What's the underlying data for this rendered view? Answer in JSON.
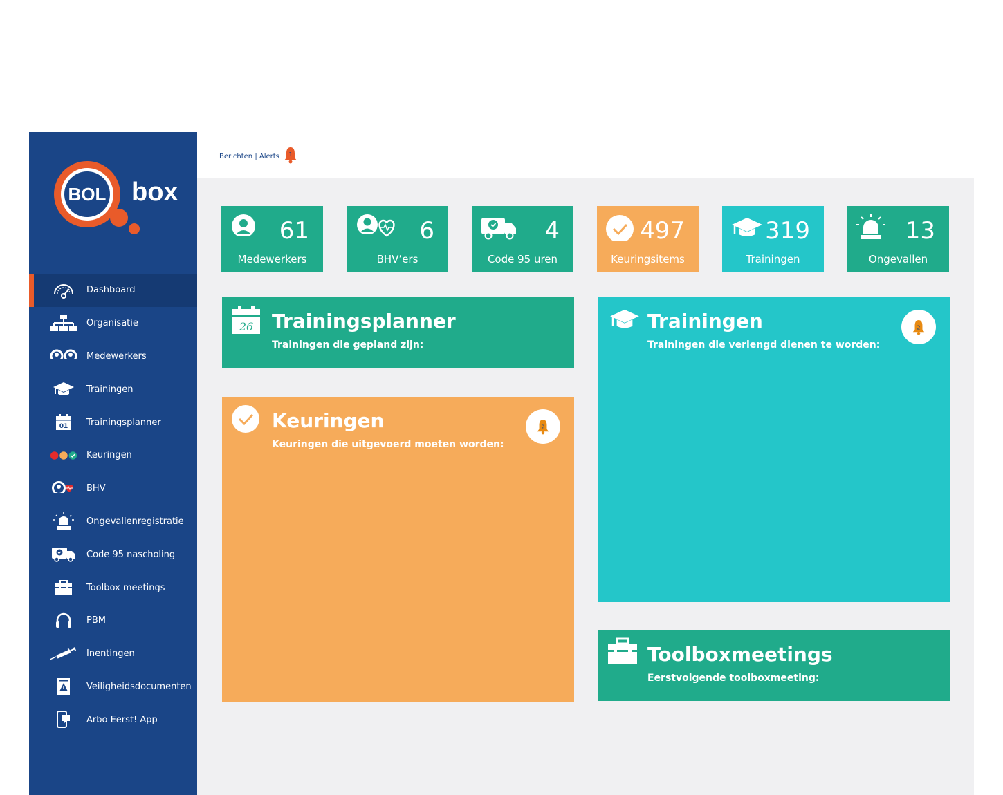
{
  "brand": {
    "logo_left": "BOL",
    "logo_right": "box",
    "primary": "#1a4587",
    "accent": "#e95b2a"
  },
  "topbar": {
    "link_text": "Berichten | Alerts",
    "alert_count": "1"
  },
  "sidebar": {
    "items": [
      {
        "label": "Dashboard",
        "icon": "gauge-icon"
      },
      {
        "label": "Organisatie",
        "icon": "org-chart-icon"
      },
      {
        "label": "Medewerkers",
        "icon": "people-icon"
      },
      {
        "label": "Trainingen",
        "icon": "graduation-cap-icon"
      },
      {
        "label": "Trainingsplanner",
        "icon": "calendar-icon",
        "day": "01"
      },
      {
        "label": "Keuringen",
        "icon": "status-dots-icon"
      },
      {
        "label": "BHV",
        "icon": "person-heart-icon"
      },
      {
        "label": "Ongevallenregistratie",
        "icon": "alarm-light-icon"
      },
      {
        "label": "Code 95 nascholing",
        "icon": "truck-icon"
      },
      {
        "label": "Toolbox meetings",
        "icon": "toolbox-icon"
      },
      {
        "label": "PBM",
        "icon": "headphones-icon"
      },
      {
        "label": "Inentingen",
        "icon": "syringe-icon"
      },
      {
        "label": "Veiligheidsdocumenten",
        "icon": "warning-document-icon"
      },
      {
        "label": "Arbo Eerst! App",
        "icon": "mobile-app-icon"
      }
    ]
  },
  "stats": [
    {
      "value": "61",
      "label": "Medewerkers",
      "icon": "person-icon",
      "color": "#20ab8b"
    },
    {
      "value": "6",
      "label": "BHV’ers",
      "icon": "person-heart-icon",
      "color": "#20ab8b"
    },
    {
      "value": "4",
      "label": "Code 95 uren",
      "icon": "truck-icon",
      "color": "#20ab8b"
    },
    {
      "value": "497",
      "label": "Keuringsitems",
      "icon": "check-circle-icon",
      "color": "#f6ab5a"
    },
    {
      "value": "319",
      "label": "Trainingen",
      "icon": "graduation-cap-icon",
      "color": "#24c6c9"
    },
    {
      "value": "13",
      "label": "Ongevallen",
      "icon": "alarm-light-icon",
      "color": "#20ab8b"
    }
  ],
  "panels": {
    "trainingsplanner": {
      "title": "Trainingsplanner",
      "subtitle": "Trainingen die gepland zijn:",
      "day": "26"
    },
    "keuringen": {
      "title": "Keuringen",
      "subtitle": "Keuringen die uitgevoerd moeten worden:",
      "alert_count": "2"
    },
    "trainingen": {
      "title": "Trainingen",
      "subtitle": "Trainingen die verlengd dienen te worden:",
      "alert_count": "2"
    },
    "toolbox": {
      "title": "Toolboxmeetings",
      "subtitle": "Eerstvolgende toolboxmeeting:"
    }
  }
}
